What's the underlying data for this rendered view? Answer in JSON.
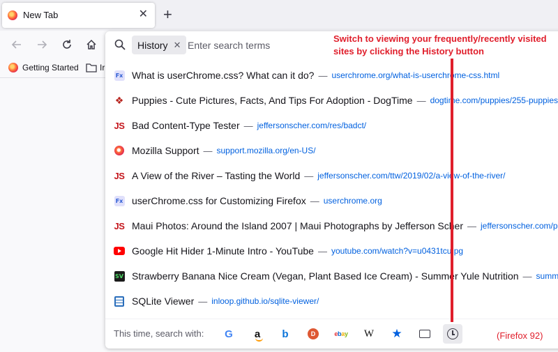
{
  "tab": {
    "title": "New Tab",
    "close": "✕",
    "new_tab": "+"
  },
  "navbar": {
    "back": "back-icon",
    "forward": "forward-icon",
    "reload": "reload-icon",
    "home": "home-icon"
  },
  "bookmarks": [
    {
      "label": "Getting Started",
      "icon": "firefox-icon"
    },
    {
      "label": "Ir",
      "icon": "folder-icon"
    }
  ],
  "search": {
    "mode_chip": "History",
    "chip_close": "✕",
    "placeholder": "Enter search terms"
  },
  "results": [
    {
      "icon": "fx",
      "title": "What is userChrome.css? What can it do?",
      "url": "userchrome.org/what-is-userchrome-css.html"
    },
    {
      "icon": "paw",
      "title": "Puppies - Cute Pictures, Facts, And Tips For Adoption - DogTime",
      "url": "dogtime.com/puppies/255-puppies"
    },
    {
      "icon": "js",
      "title": "Bad Content-Type Tester",
      "url": "jeffersonscher.com/res/badct/"
    },
    {
      "icon": "moz",
      "title": "Mozilla Support",
      "url": "support.mozilla.org/en-US/"
    },
    {
      "icon": "js",
      "title": "A View of the River – Tasting the World",
      "url": "jeffersonscher.com/ttw/2019/02/a-view-of-the-river/"
    },
    {
      "icon": "fx",
      "title": "userChrome.css for Customizing Firefox",
      "url": "userchrome.org"
    },
    {
      "icon": "js",
      "title": "Maui Photos: Around the Island 2007 | Maui Photographs by Jefferson Scher",
      "url": "jeffersonscher.com/ph"
    },
    {
      "icon": "yt",
      "title": "Google Hit Hider 1-Minute Intro - YouTube",
      "url": "youtube.com/watch?v=u0431tcuIpg"
    },
    {
      "icon": "sv",
      "title": "Strawberry Banana Nice Cream (Vegan, Plant Based Ice Cream) - Summer Yule Nutrition",
      "url": "summery"
    },
    {
      "icon": "db",
      "title": "SQLite Viewer",
      "url": "inloop.github.io/sqlite-viewer/"
    }
  ],
  "separator": "—",
  "footer": {
    "label": "This time, search with:",
    "engines": [
      {
        "name": "google-icon",
        "glyph": "G"
      },
      {
        "name": "amazon-icon",
        "glyph": "a"
      },
      {
        "name": "bing-icon",
        "glyph": "b"
      },
      {
        "name": "duckduckgo-icon",
        "glyph": "D"
      },
      {
        "name": "ebay-icon",
        "glyph": "ebay"
      },
      {
        "name": "wikipedia-icon",
        "glyph": "W"
      },
      {
        "name": "bookmarks-star-icon",
        "glyph": "★"
      },
      {
        "name": "tabs-icon",
        "glyph": ""
      },
      {
        "name": "history-clock-icon",
        "glyph": ""
      }
    ]
  },
  "annotation": {
    "text": "Switch to viewing your frequently/recently visited sites by clicking the History button",
    "version": "(Firefox 92)",
    "color": "#e01e2b"
  },
  "colors": {
    "accent": "#0060df",
    "chip_bg": "#e9e9ed"
  }
}
